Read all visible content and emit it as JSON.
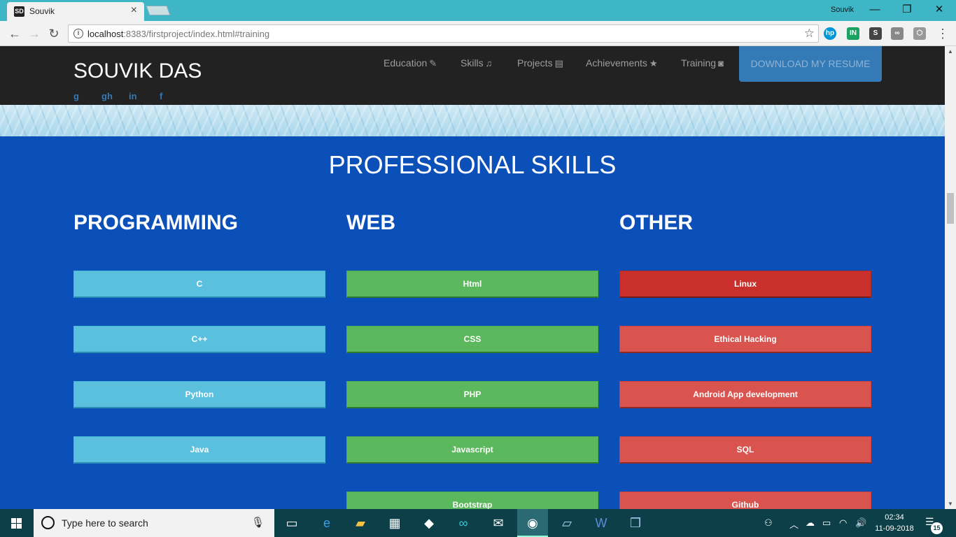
{
  "browser": {
    "tab_title": "Souvik",
    "tab_favicon": "SD",
    "profile_name": "Souvik",
    "url_host": "localhost",
    "url_rest": ":8383/firstproject/index.html#training",
    "window_controls": {
      "minimize": "—",
      "maximize": "❐",
      "close": "✕"
    }
  },
  "navbar": {
    "brand": "SOUVIK DAS",
    "social": [
      "g",
      "gh",
      "in",
      "f"
    ],
    "links": [
      {
        "label": "Education",
        "icon": "✎"
      },
      {
        "label": "Skills",
        "icon": "♫"
      },
      {
        "label": "Projects",
        "icon": "▤"
      },
      {
        "label": "Achievements",
        "icon": "★"
      },
      {
        "label": "Training",
        "icon": "◙"
      }
    ],
    "resume_button": "DOWNLOAD MY RESUME"
  },
  "skills": {
    "title": "PROFESSIONAL SKILLS",
    "columns": [
      {
        "heading": "PROGRAMMING",
        "items": [
          "C",
          "C++",
          "Python",
          "Java"
        ]
      },
      {
        "heading": "WEB",
        "items": [
          "Html",
          "CSS",
          "PHP",
          "Javascript",
          "Bootstrap"
        ]
      },
      {
        "heading": "OTHER",
        "items": [
          "Linux",
          "Ethical Hacking",
          "Android App development",
          "SQL",
          "Github"
        ]
      }
    ]
  },
  "taskbar": {
    "search_placeholder": "Type here to search",
    "time": "02:34",
    "date": "11-09-2018",
    "notification_count": "15"
  },
  "colors": {
    "page_bg": "#0b4fb8",
    "navbar_bg": "#222222",
    "info": "#5bc0de",
    "success": "#5cb85c",
    "danger": "#d9534f",
    "primary": "#337ab7"
  }
}
